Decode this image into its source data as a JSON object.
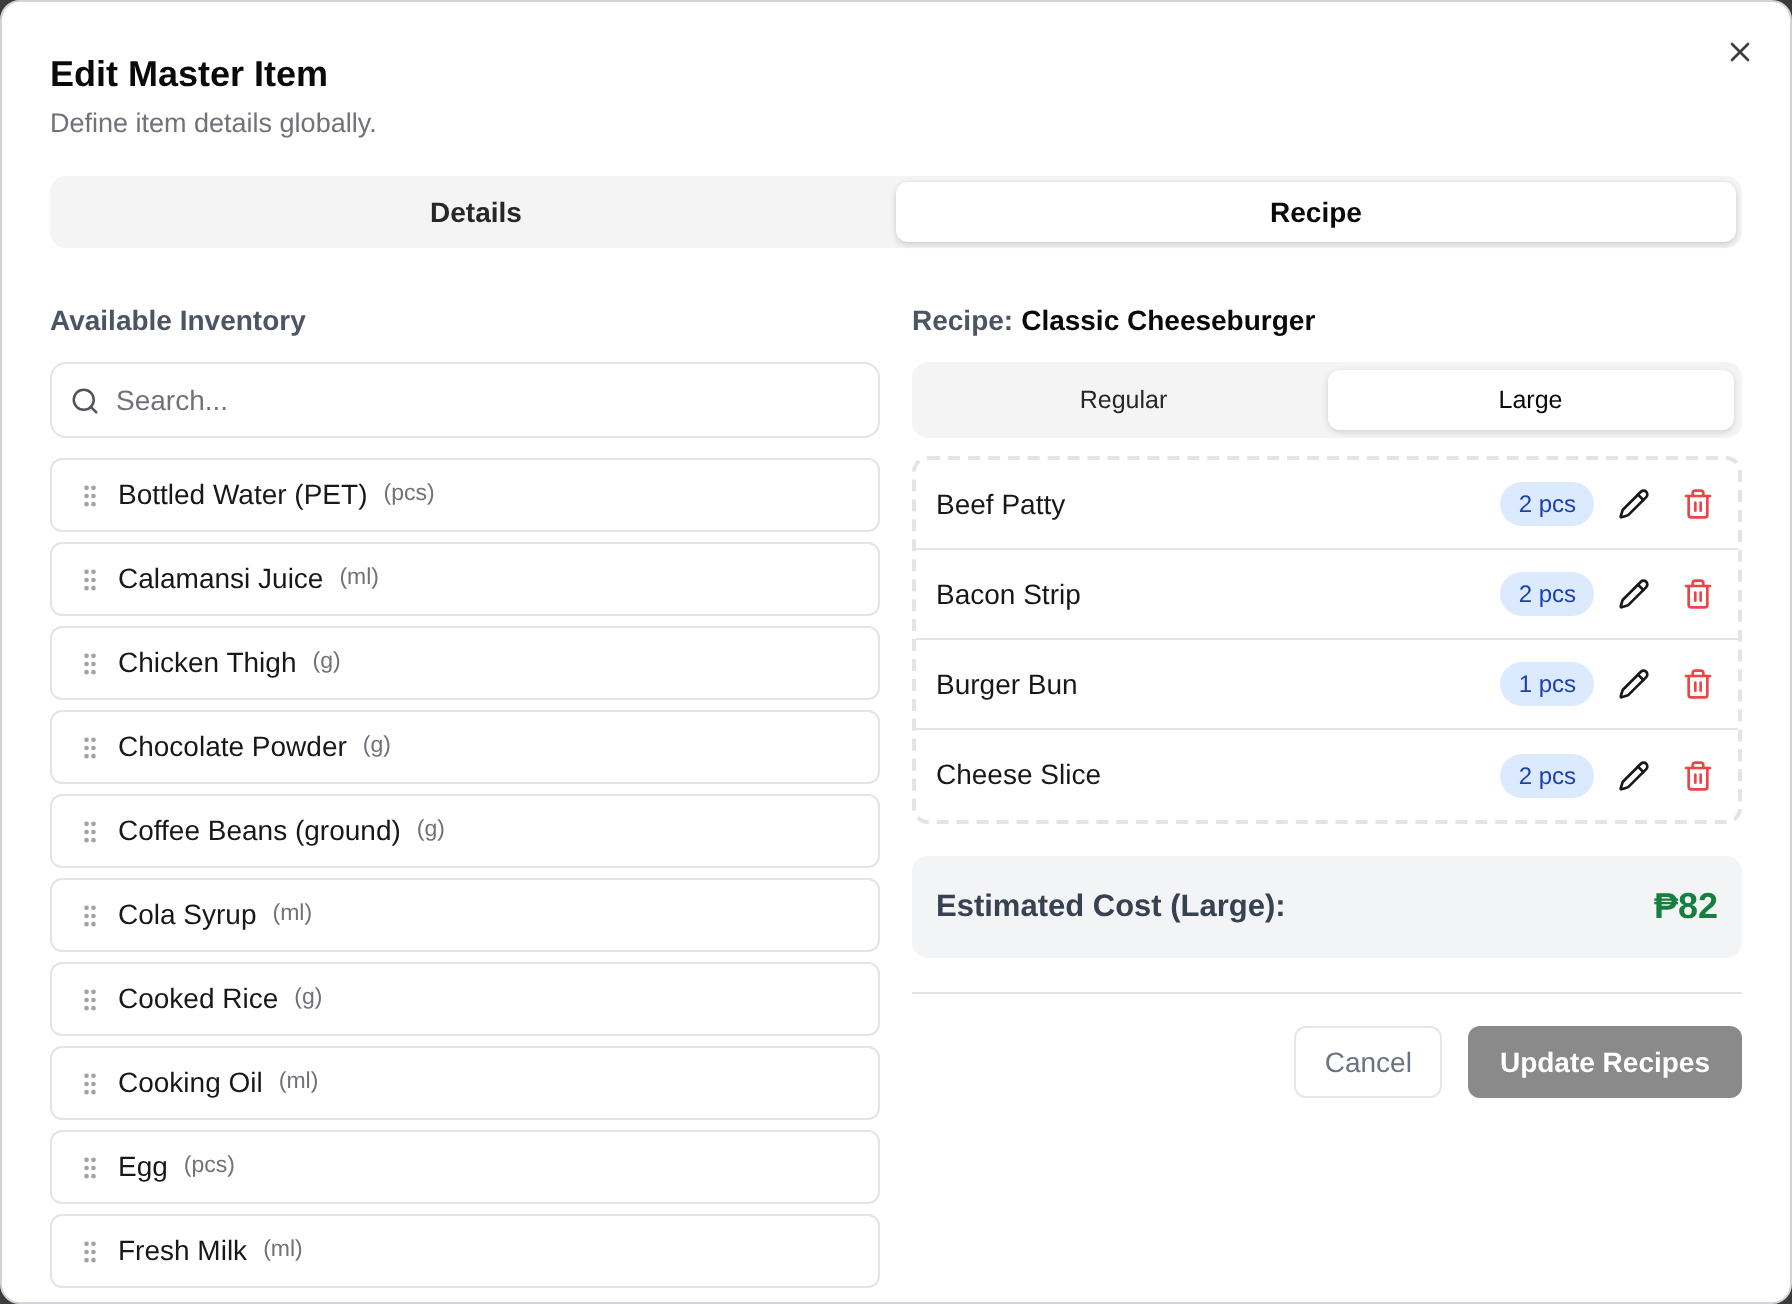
{
  "dialog": {
    "title": "Edit Master Item",
    "subtitle": "Define item details globally."
  },
  "tabs": [
    {
      "label": "Details",
      "selected": false
    },
    {
      "label": "Recipe",
      "selected": true
    }
  ],
  "inventory": {
    "heading": "Available Inventory",
    "search": {
      "placeholder": "Search..."
    },
    "items": [
      {
        "name": "Bottled Water (PET)",
        "unit": "(pcs)"
      },
      {
        "name": "Calamansi Juice",
        "unit": "(ml)"
      },
      {
        "name": "Chicken Thigh",
        "unit": "(g)"
      },
      {
        "name": "Chocolate Powder",
        "unit": "(g)"
      },
      {
        "name": "Coffee Beans (ground)",
        "unit": "(g)"
      },
      {
        "name": "Cola Syrup",
        "unit": "(ml)"
      },
      {
        "name": "Cooked Rice",
        "unit": "(g)"
      },
      {
        "name": "Cooking Oil",
        "unit": "(ml)"
      },
      {
        "name": "Egg",
        "unit": "(pcs)"
      },
      {
        "name": "Fresh Milk",
        "unit": "(ml)"
      }
    ]
  },
  "recipe": {
    "label": "Recipe:",
    "name": "Classic Cheeseburger",
    "sizes": [
      {
        "label": "Regular",
        "selected": false
      },
      {
        "label": "Large",
        "selected": true
      }
    ],
    "ingredients": [
      {
        "name": "Beef Patty",
        "quantity": "2 pcs"
      },
      {
        "name": "Bacon Strip",
        "quantity": "2 pcs"
      },
      {
        "name": "Burger Bun",
        "quantity": "1 pcs"
      },
      {
        "name": "Cheese Slice",
        "quantity": "2 pcs"
      }
    ],
    "cost": {
      "label": "Estimated Cost (Large):",
      "value": "₱82"
    }
  },
  "buttons": [
    {
      "label": "Cancel",
      "kind": "secondary",
      "disabled": false
    },
    {
      "label": "Update Recipes",
      "kind": "primary",
      "disabled": true
    }
  ]
}
